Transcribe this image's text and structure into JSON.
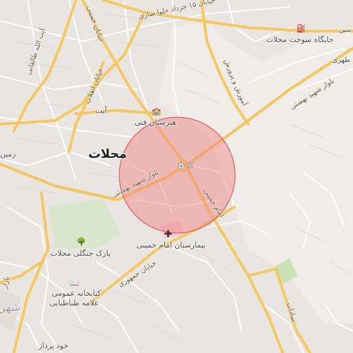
{
  "map": {
    "city_label": "محلات",
    "marker": {
      "color": "#f08080"
    },
    "colors": {
      "background": "#f0ede8",
      "major_road": "#f7c95f",
      "minor_road": "#ffffff",
      "park": "#d4e8c6",
      "hospital": "#f6c8d6"
    },
    "labels": {
      "amusement": "آیت",
      "hoonarestan": "هنرستان فنی",
      "zamin": "زمین",
      "gas_station": "جایگاه سوخت محلات",
      "park": "پارک جنگلی محلات",
      "hospital": "بیمارستان امام خمینی",
      "library_line1": "کتابخانه عمومی",
      "library_line2": "علامه طباطبایی",
      "khod_pardaz": "خود پرداز",
      "shahr_fragment": "شهر",
      "sin_fragment": "سین",
      "tahi_fragment": "طهری"
    },
    "roads": {
      "khordad": "خیابان ۱۵ خرداد حلوا سازی",
      "khomeini": "خیابان خمینی",
      "ayatollah": "آیت الله طالقانی",
      "enghelab": "خیابان انقلاب",
      "beheshti_e": "بلوار شهید بهشتی",
      "beheshti_w": "بلوار شهید بهشتی",
      "amoozesh": "آموزش و پرورش",
      "imam": "امام خمینی",
      "jomhouri": "خیابان جمهوری",
      "sadat": "سادات",
      "bazar": "بازار"
    },
    "icons": [
      "gas-station-icon",
      "school-icon",
      "shop-icon",
      "hospital-icon",
      "park-tree-icon",
      "library-icon",
      "location-dot-icon"
    ]
  }
}
